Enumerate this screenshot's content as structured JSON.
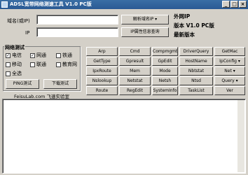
{
  "window": {
    "title": "ADSL宽带网络测速工具 V1.0 PC版",
    "minimize": "_",
    "maximize": "□",
    "close": "×"
  },
  "domain_label": "域名(或IP)",
  "ip_label": "IP",
  "resolve_button": "解析域名IP",
  "ip_query_button": "IP属性信息查询",
  "info": {
    "external_ip": "外网IP",
    "version": "版本 V1.0 PC版",
    "latest": "最新版本"
  },
  "network_test": {
    "title": "网络测试",
    "options": [
      {
        "label": "电信",
        "checked": true
      },
      {
        "label": "网通",
        "checked": true
      },
      {
        "label": "铁通",
        "checked": false
      },
      {
        "label": "移动",
        "checked": false
      },
      {
        "label": "联通",
        "checked": false
      },
      {
        "label": "教育网",
        "checked": false
      }
    ],
    "select_all": "全选",
    "ping_button": "PING测试",
    "download_button": "下载测试"
  },
  "footer": "FeisuLab.com 飞速实验室",
  "commands": [
    [
      "Arp",
      "Cmd",
      "Compmgmt",
      "DriverQuery",
      "GetMac"
    ],
    [
      "GetType",
      "Gpresult",
      "GpEdit",
      "HostName",
      "IpConfig"
    ],
    [
      "IpxRoute",
      "Mem",
      "Mode",
      "Nbtstat",
      "Net"
    ],
    [
      "Nslookup",
      "Netstat",
      "Netsh",
      "Ntsd",
      "Query"
    ],
    [
      "Route",
      "RegEdit",
      "SystemInfo",
      "TaskList",
      "Ver"
    ]
  ],
  "dropdown_commands": [
    "IpConfig",
    "Net",
    "Query"
  ],
  "output": ""
}
